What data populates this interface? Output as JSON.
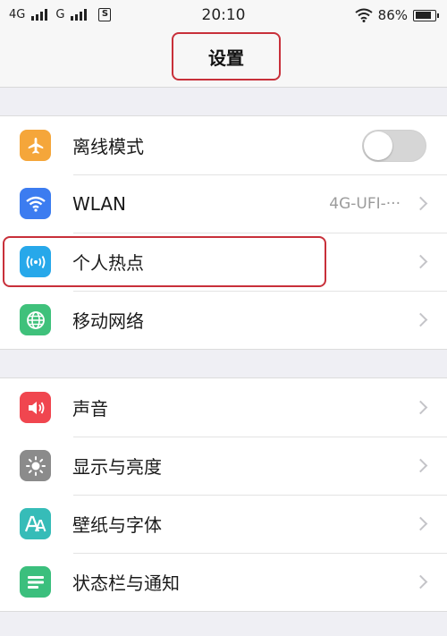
{
  "status_bar": {
    "net1": "4G",
    "net2": "G",
    "sim_label": "S",
    "time": "20:10",
    "battery_text": "86%",
    "battery_level": 0.86
  },
  "navbar": {
    "title": "设置"
  },
  "groups": [
    {
      "rows": [
        {
          "label": "离线模式",
          "icon": "airplane-icon",
          "icon_color": "#f5a63a",
          "toggle": false
        },
        {
          "label": "WLAN",
          "icon": "wifi-icon",
          "icon_color": "#3c7cf0",
          "value": "4G-UFI-···"
        },
        {
          "label": "个人热点",
          "icon": "hotspot-icon",
          "icon_color": "#27a8ea"
        },
        {
          "label": "移动网络",
          "icon": "globe-icon",
          "icon_color": "#3fc17b"
        }
      ]
    },
    {
      "rows": [
        {
          "label": "声音",
          "icon": "speaker-icon",
          "icon_color": "#f0464f"
        },
        {
          "label": "显示与亮度",
          "icon": "brightness-icon",
          "icon_color": "#8b8b8b"
        },
        {
          "label": "壁纸与字体",
          "icon": "font-icon",
          "icon_color": "#36bcb8"
        },
        {
          "label": "状态栏与通知",
          "icon": "notification-list-icon",
          "icon_color": "#3bbf7d"
        }
      ]
    }
  ]
}
